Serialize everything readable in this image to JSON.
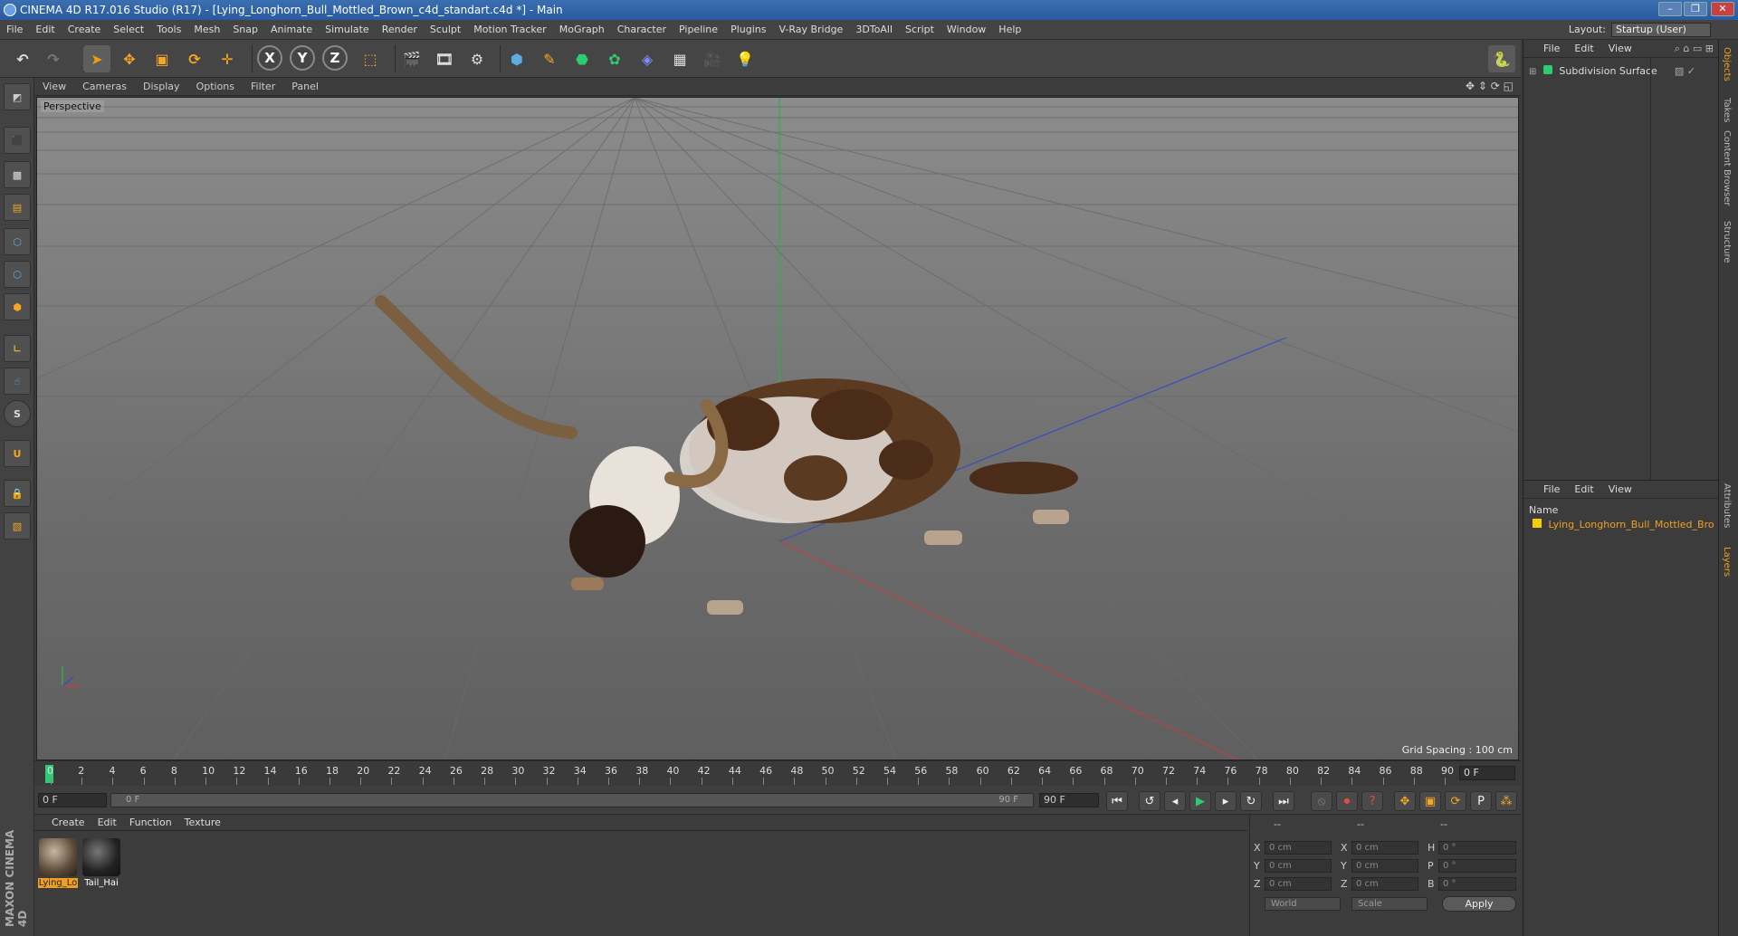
{
  "window": {
    "title": "CINEMA 4D R17.016 Studio (R17) - [Lying_Longhorn_Bull_Mottled_Brown_c4d_standart.c4d *] - Main",
    "min_label": "–",
    "max_label": "❐",
    "close_label": "✕"
  },
  "menu": [
    "File",
    "Edit",
    "Create",
    "Select",
    "Tools",
    "Mesh",
    "Snap",
    "Animate",
    "Simulate",
    "Render",
    "Sculpt",
    "Motion Tracker",
    "MoGraph",
    "Character",
    "Pipeline",
    "Plugins",
    "V-Ray Bridge",
    "3DToAll",
    "Script",
    "Window",
    "Help"
  ],
  "layout": {
    "label": "Layout:",
    "value": "Startup (User)"
  },
  "toolbar": {
    "axis_x": "X",
    "axis_y": "Y",
    "axis_z": "Z"
  },
  "viewport": {
    "menu": [
      "View",
      "Cameras",
      "Display",
      "Options",
      "Filter",
      "Panel"
    ],
    "camera_label": "Perspective",
    "grid_spacing": "Grid Spacing : 100 cm"
  },
  "timeline": {
    "ticks": [
      "0",
      "2",
      "4",
      "6",
      "8",
      "10",
      "12",
      "14",
      "16",
      "18",
      "20",
      "22",
      "24",
      "26",
      "28",
      "30",
      "32",
      "34",
      "36",
      "38",
      "40",
      "42",
      "44",
      "46",
      "48",
      "50",
      "52",
      "54",
      "56",
      "58",
      "60",
      "62",
      "64",
      "66",
      "68",
      "70",
      "72",
      "74",
      "76",
      "78",
      "80",
      "82",
      "84",
      "86",
      "88",
      "90"
    ],
    "current_frame": "0 F"
  },
  "transport": {
    "start_frame": "0 F",
    "range_start": "0 F",
    "range_end": "90 F",
    "end_frame": "90 F"
  },
  "material_manager": {
    "menu": [
      "Create",
      "Edit",
      "Function",
      "Texture"
    ],
    "materials": [
      {
        "name": "Lying_Lo",
        "color": "#8a7a66"
      },
      {
        "name": "Tail_Hai",
        "color": "#2a2a2a"
      }
    ]
  },
  "coordinates": {
    "header": [
      "--",
      "--",
      "--"
    ],
    "rows": [
      {
        "a": "X",
        "av": "0 cm",
        "b": "X",
        "bv": "0 cm",
        "c": "H",
        "cv": "0 °"
      },
      {
        "a": "Y",
        "av": "0 cm",
        "b": "Y",
        "bv": "0 cm",
        "c": "P",
        "cv": "0 °"
      },
      {
        "a": "Z",
        "av": "0 cm",
        "b": "Z",
        "bv": "0 cm",
        "c": "B",
        "cv": "0 °"
      }
    ],
    "space": "World",
    "mode": "Scale",
    "apply": "Apply"
  },
  "object_manager": {
    "menu": [
      "File",
      "Edit",
      "View"
    ],
    "objects": [
      "Subdivision Surface"
    ]
  },
  "layer_manager": {
    "menu": [
      "File",
      "Edit",
      "View"
    ],
    "column_name": "Name",
    "layers": [
      "Lying_Longhorn_Bull_Mottled_Bro"
    ]
  },
  "side_tabs": [
    "Objects",
    "Takes",
    "Content Browser",
    "Structure",
    "Attributes",
    "Layers"
  ],
  "brand": "MAXON CINEMA 4D",
  "colors": {
    "accent_orange": "#f0a020",
    "playhead_green": "#2ecc71",
    "layer_yellow": "#f5d000"
  }
}
